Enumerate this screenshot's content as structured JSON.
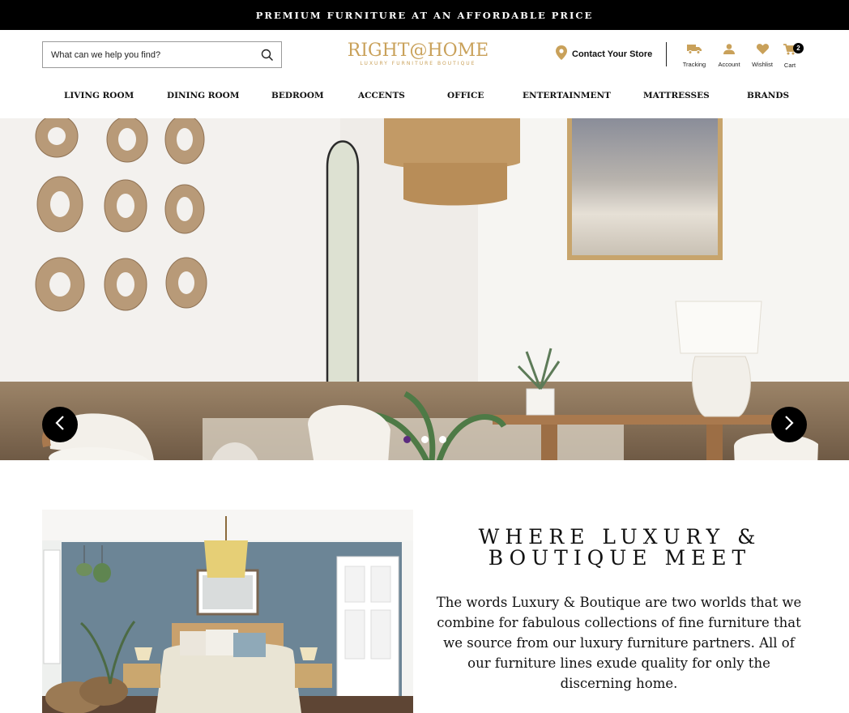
{
  "announcement": "PREMIUM FURNITURE AT AN AFFORDABLE PRICE",
  "search": {
    "placeholder": "What can we help you find?"
  },
  "logo": {
    "main": "RIGHT@HOME",
    "sub": "LUXURY FURNITURE BOUTIQUE"
  },
  "contact": {
    "label": "Contact Your Store"
  },
  "utility": {
    "tracking": "Tracking",
    "account": "Account",
    "wishlist": "Wishlist",
    "cart": "Cart",
    "cart_count": "2"
  },
  "nav": [
    "LIVING ROOM",
    "DINING ROOM",
    "BEDROOM",
    "ACCENTS",
    "OFFICE",
    "ENTERTAINMENT",
    "MATTRESSES",
    "BRANDS"
  ],
  "carousel": {
    "slide_count": 3,
    "active_slide": 1
  },
  "feature": {
    "headline_line1": "WHERE LUXURY &",
    "headline_line2": "BOUTIQUE MEET",
    "body": "The words Luxury & Boutique are two worlds that we combine for fabulous collections of fine furniture that we source from our luxury furniture partners. All of our furniture lines exude quality for only the discerning home."
  },
  "colors": {
    "accent_gold": "#c9a15a",
    "active_dot": "#5b2b7f",
    "bar": "#000000"
  }
}
